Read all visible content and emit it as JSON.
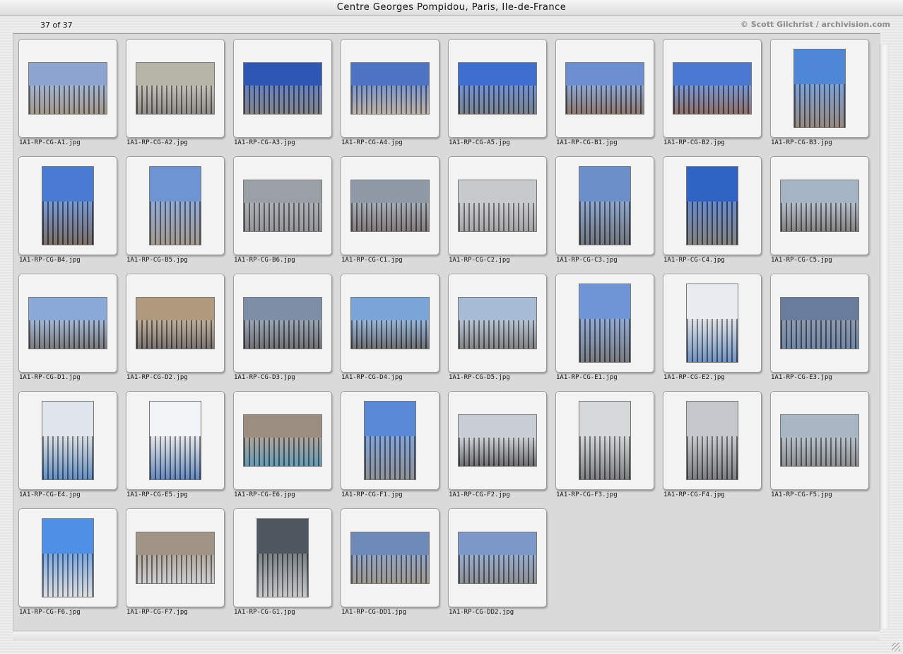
{
  "window": {
    "title": "Centre Georges Pompidou, Paris, Ile-de-France"
  },
  "header": {
    "count_text": "37 of 37",
    "credit_text": "© Scott Gilchrist / archivision.com"
  },
  "gallery": {
    "items": [
      {
        "filename": "1A1-RP-CG-A1.jpg",
        "orientation": "landscape",
        "sky": "#8da5cf",
        "ground": "#8a7a66"
      },
      {
        "filename": "1A1-RP-CG-A2.jpg",
        "orientation": "landscape",
        "sky": "#b7b4a8",
        "ground": "#6f6a62"
      },
      {
        "filename": "1A1-RP-CG-A3.jpg",
        "orientation": "landscape",
        "sky": "#2f57b5",
        "ground": "#5b5b62"
      },
      {
        "filename": "1A1-RP-CG-A4.jpg",
        "orientation": "landscape",
        "sky": "#4d74c4",
        "ground": "#b3a393"
      },
      {
        "filename": "1A1-RP-CG-A5.jpg",
        "orientation": "landscape",
        "sky": "#3e6fd0",
        "ground": "#4f5868"
      },
      {
        "filename": "1A1-RP-CG-B1.jpg",
        "orientation": "landscape",
        "sky": "#6b8fd0",
        "ground": "#6a4a3c"
      },
      {
        "filename": "1A1-RP-CG-B2.jpg",
        "orientation": "landscape",
        "sky": "#4b78d0",
        "ground": "#6b3c34"
      },
      {
        "filename": "1A1-RP-CG-B3.jpg",
        "orientation": "portrait",
        "sky": "#4f86d6",
        "ground": "#7a6458"
      },
      {
        "filename": "1A1-RP-CG-B4.jpg",
        "orientation": "portrait",
        "sky": "#4a7bd2",
        "ground": "#4d3a30"
      },
      {
        "filename": "1A1-RP-CG-B5.jpg",
        "orientation": "portrait",
        "sky": "#6f94d4",
        "ground": "#8a7c6d"
      },
      {
        "filename": "1A1-RP-CG-B6.jpg",
        "orientation": "landscape",
        "sky": "#9aa0a6",
        "ground": "#77777c"
      },
      {
        "filename": "1A1-RP-CG-C1.jpg",
        "orientation": "landscape",
        "sky": "#8f9aa6",
        "ground": "#5a4d4d"
      },
      {
        "filename": "1A1-RP-CG-C2.jpg",
        "orientation": "landscape",
        "sky": "#c7c9cc",
        "ground": "#8d8d8f"
      },
      {
        "filename": "1A1-RP-CG-C3.jpg",
        "orientation": "portrait",
        "sky": "#6a8fc9",
        "ground": "#3f4650"
      },
      {
        "filename": "1A1-RP-CG-C4.jpg",
        "orientation": "portrait",
        "sky": "#2f63c4",
        "ground": "#5d5a56"
      },
      {
        "filename": "1A1-RP-CG-C5.jpg",
        "orientation": "landscape",
        "sky": "#a5b4c4",
        "ground": "#5d5a58"
      },
      {
        "filename": "1A1-RP-CG-D1.jpg",
        "orientation": "landscape",
        "sky": "#8aa9d6",
        "ground": "#4d4d4f"
      },
      {
        "filename": "1A1-RP-CG-D2.jpg",
        "orientation": "landscape",
        "sky": "#b09a7e",
        "ground": "#4c4440"
      },
      {
        "filename": "1A1-RP-CG-D3.jpg",
        "orientation": "landscape",
        "sky": "#7d8ea6",
        "ground": "#3e3e42"
      },
      {
        "filename": "1A1-RP-CG-D4.jpg",
        "orientation": "landscape",
        "sky": "#7aa5d8",
        "ground": "#3c3d44"
      },
      {
        "filename": "1A1-RP-CG-D5.jpg",
        "orientation": "landscape",
        "sky": "#a9bcd6",
        "ground": "#5a5a5c"
      },
      {
        "filename": "1A1-RP-CG-E1.jpg",
        "orientation": "portrait",
        "sky": "#6f95d6",
        "ground": "#4b4e55"
      },
      {
        "filename": "1A1-RP-CG-E2.jpg",
        "orientation": "portrait",
        "sky": "#e9edf2",
        "ground": "#3e70b5"
      },
      {
        "filename": "1A1-RP-CG-E3.jpg",
        "orientation": "landscape",
        "sky": "#6a7c9c",
        "ground": "#3f5f8c"
      },
      {
        "filename": "1A1-RP-CG-E4.jpg",
        "orientation": "portrait",
        "sky": "#e0e6ec",
        "ground": "#2c6cb8"
      },
      {
        "filename": "1A1-RP-CG-E5.jpg",
        "orientation": "portrait",
        "sky": "#f1f3f6",
        "ground": "#2e63b0"
      },
      {
        "filename": "1A1-RP-CG-E6.jpg",
        "orientation": "landscape",
        "sky": "#9b8d80",
        "ground": "#2d7ea6"
      },
      {
        "filename": "1A1-RP-CG-F1.jpg",
        "orientation": "portrait",
        "sky": "#5a8ad6",
        "ground": "#6c6f7a"
      },
      {
        "filename": "1A1-RP-CG-F2.jpg",
        "orientation": "landscape",
        "sky": "#c9ced6",
        "ground": "#3a3a3e"
      },
      {
        "filename": "1A1-RP-CG-F3.jpg",
        "orientation": "portrait",
        "sky": "#d6d8da",
        "ground": "#525459"
      },
      {
        "filename": "1A1-RP-CG-F4.jpg",
        "orientation": "portrait",
        "sky": "#c4c7cb",
        "ground": "#4f5157"
      },
      {
        "filename": "1A1-RP-CG-F5.jpg",
        "orientation": "landscape",
        "sky": "#a9b6c4",
        "ground": "#6a6d70"
      },
      {
        "filename": "1A1-RP-CG-F6.jpg",
        "orientation": "portrait",
        "sky": "#4f8fe6",
        "ground": "#e5e7ea"
      },
      {
        "filename": "1A1-RP-CG-F7.jpg",
        "orientation": "landscape",
        "sky": "#a09486",
        "ground": "#cfcfd1"
      },
      {
        "filename": "1A1-RP-CG-G1.jpg",
        "orientation": "portrait",
        "sky": "#4f5860",
        "ground": "#c2c5c9"
      },
      {
        "filename": "1A1-RP-CG-DD1.jpg",
        "orientation": "landscape",
        "sky": "#6e8ab8",
        "ground": "#857c70"
      },
      {
        "filename": "1A1-RP-CG-DD2.jpg",
        "orientation": "landscape",
        "sky": "#7b98c8",
        "ground": "#6a6e74"
      }
    ]
  }
}
